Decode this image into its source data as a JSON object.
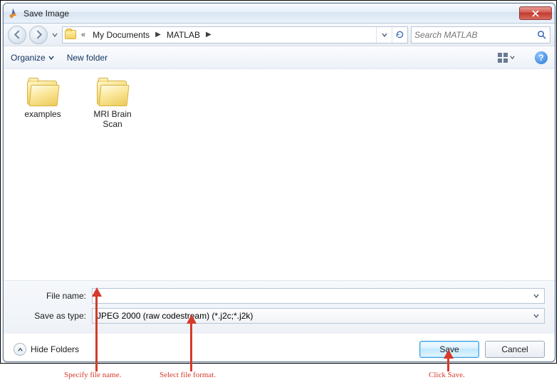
{
  "window": {
    "title": "Save Image"
  },
  "nav": {
    "crumb_prefix": "«",
    "crumbs": [
      "My Documents",
      "MATLAB"
    ]
  },
  "search": {
    "placeholder": "Search MATLAB"
  },
  "toolbar": {
    "organize": "Organize",
    "new_folder": "New folder"
  },
  "files": {
    "items": [
      {
        "label": "examples"
      },
      {
        "label": "MRI Brain Scan"
      }
    ]
  },
  "form": {
    "filename_label": "File name:",
    "filename_value": "",
    "type_label": "Save as type:",
    "type_value": "JPEG 2000 (raw codestream) (*.j2c;*.j2k)"
  },
  "actions": {
    "hide_folders": "Hide Folders",
    "save": "Save",
    "cancel": "Cancel"
  },
  "annotations": {
    "a1": "Specify file name.",
    "a2": "Select file format.",
    "a3": "Click Save."
  }
}
